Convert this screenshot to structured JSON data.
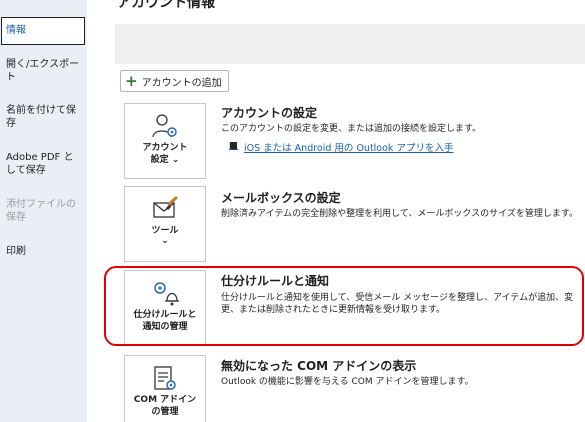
{
  "sidebar": {
    "items": [
      {
        "label": "情報"
      },
      {
        "label": "開く/エクスポート"
      },
      {
        "label": "名前を付けて保存"
      },
      {
        "label": "Adobe PDF として保存"
      },
      {
        "label": "添付ファイルの保存"
      },
      {
        "label": "印刷"
      }
    ]
  },
  "main": {
    "title": "アカウント情報",
    "add_account_label": "アカウントの追加",
    "sections": [
      {
        "tile_label_line1": "アカウント",
        "tile_label_line2": "設定",
        "tile_chevron": "⌄",
        "title": "アカウントの設定",
        "desc": "このアカウントの設定を変更、または追加の接続を設定します。",
        "link": "iOS または Android 用の Outlook アプリを入手"
      },
      {
        "tile_label_line1": "ツール",
        "tile_chevron": "⌄",
        "title": "メールボックスの設定",
        "desc": "削除済みアイテムの完全削除や整理を利用して、メールボックスのサイズを管理します。"
      },
      {
        "tile_label_line1": "仕分けルールと",
        "tile_label_line2": "通知の管理",
        "title": "仕分けルールと通知",
        "desc": "仕分けルールと通知を使用して、受信メール メッセージを整理し、アイテムが追加、変更、または削除されたときに更新情報を受け取ります。"
      },
      {
        "tile_label_line1": "COM アドイン",
        "tile_label_line2": "の管理",
        "title": "無効になった COM アドインの表示",
        "desc": "Outlook の機能に影響を与える COM アドインを管理します。"
      }
    ]
  },
  "colors": {
    "sidebar_bg": "#e9eff5",
    "accent": "#1f5fa6",
    "highlight": "#e00000",
    "icon_blue": "#2b6cb0"
  }
}
